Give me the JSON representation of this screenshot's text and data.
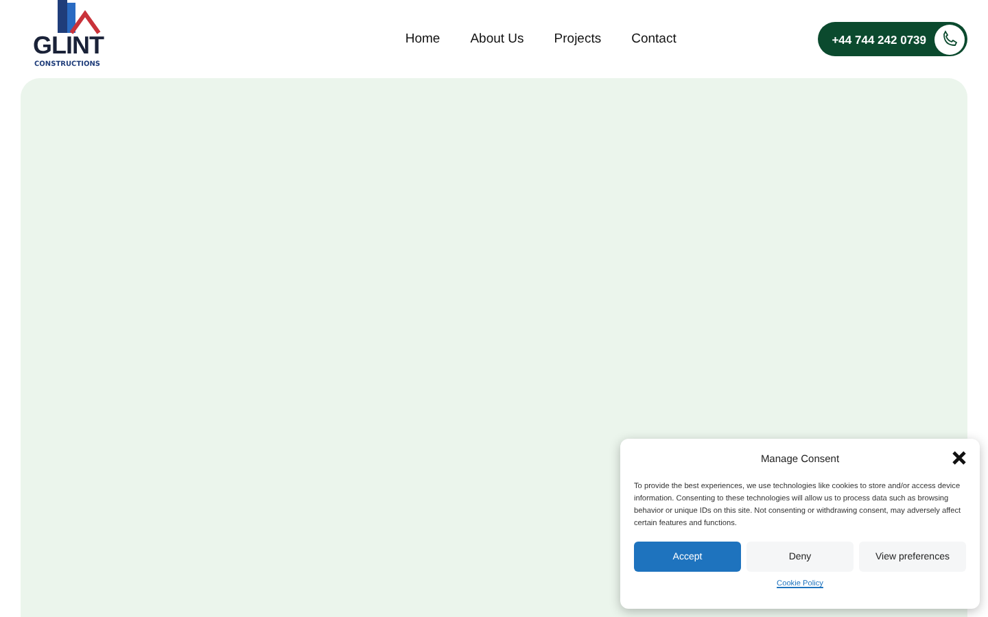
{
  "logo": {
    "name": "GLINT",
    "tagline": "CONSTRUCTIONS"
  },
  "nav": [
    "Home",
    "About Us",
    "Projects",
    "Contact"
  ],
  "phone": "+44 744 242 0739",
  "consent": {
    "title": "Manage Consent",
    "text": "To provide the best experiences, we use technologies like cookies to store and/or access device information. Consenting to these technologies will allow us to process data such as browsing behavior or unique IDs on this site. Not consenting or withdrawing consent, may adversely affect certain features and functions.",
    "buttons": [
      {
        "label": "Accept",
        "kind": "primary"
      },
      {
        "label": "Deny",
        "kind": "plain"
      },
      {
        "label": "View preferences",
        "kind": "plain"
      }
    ],
    "link": "Cookie Policy"
  }
}
